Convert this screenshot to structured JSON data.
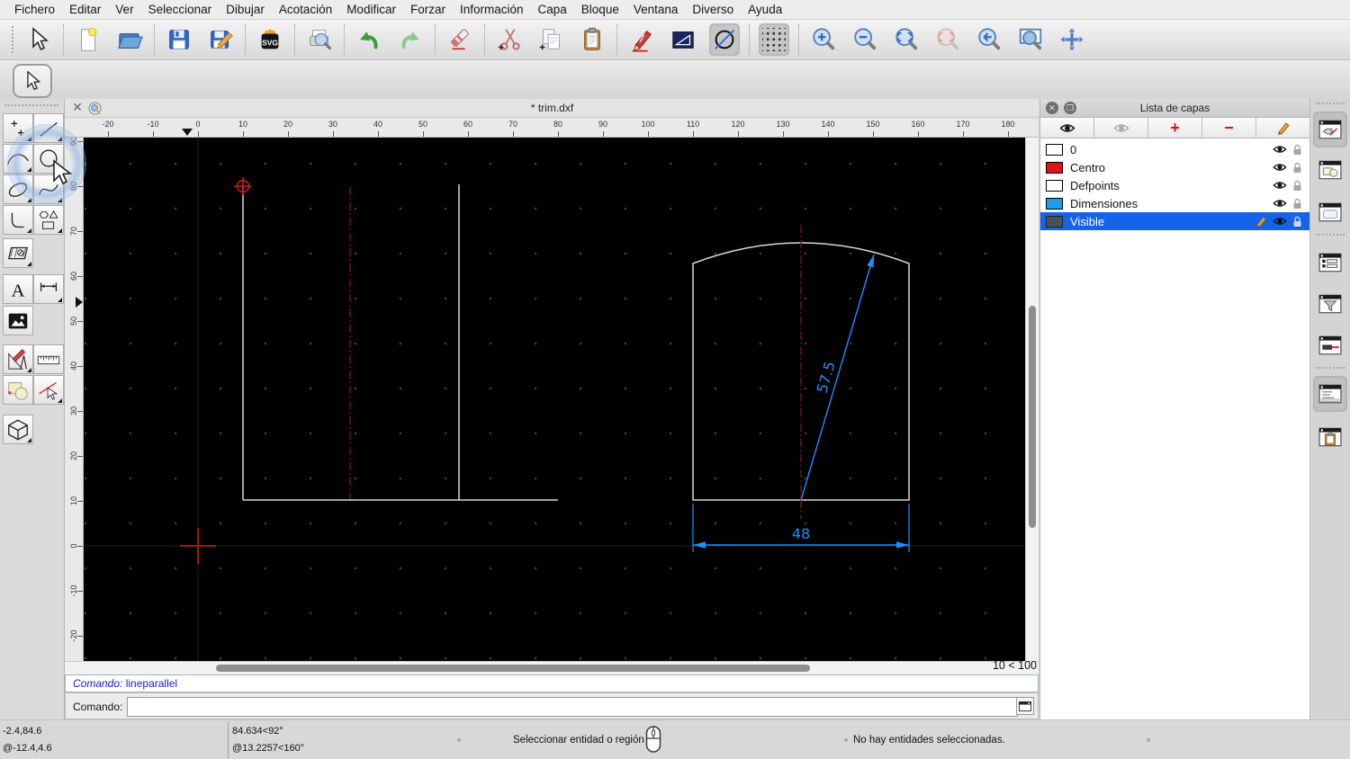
{
  "menu_bar": {
    "items": [
      "Fichero",
      "Editar",
      "Ver",
      "Seleccionar",
      "Dibujar",
      "Acotación",
      "Modificar",
      "Forzar",
      "Información",
      "Capa",
      "Bloque",
      "Ventana",
      "Diverso",
      "Ayuda"
    ]
  },
  "main_toolbar": {
    "buttons": [
      "select-pointer",
      "new-file",
      "open-file",
      "save",
      "save-as",
      "export-svg",
      "print-preview",
      "undo",
      "redo",
      "delete-eraser",
      "cut",
      "copy",
      "paste",
      "draw-pencil",
      "line-angle",
      "circle-trim",
      "grid-toggle",
      "zoom-in",
      "zoom-out",
      "zoom-auto",
      "zoom-selection",
      "zoom-previous",
      "zoom-window",
      "zoom-pan"
    ],
    "active_buttons": [
      "circle-trim",
      "grid-toggle"
    ],
    "disabled_buttons": [
      "zoom-selection"
    ]
  },
  "left_palette": {
    "tools": [
      "points",
      "lines",
      "arcs",
      "circles",
      "ellipses",
      "splines",
      "polylines",
      "shapes",
      "hatch",
      "text",
      "dimensions",
      "image",
      "misc-tools",
      "ruler",
      "modify",
      "trim",
      "isometric"
    ],
    "hovered_tool": "circles"
  },
  "document_tab": {
    "title": "* trim.dxf"
  },
  "rulers": {
    "horizontal": [
      "-20",
      "-10",
      "0",
      "10",
      "20",
      "30",
      "40",
      "50",
      "60",
      "70",
      "80",
      "90",
      "100",
      "110",
      "120",
      "130",
      "140",
      "150",
      "160",
      "170",
      "180"
    ],
    "vertical": [
      "90",
      "80",
      "70",
      "60",
      "50",
      "40",
      "30",
      "20",
      "10",
      "0",
      "-10",
      "-20"
    ]
  },
  "drawing": {
    "dim_diagonal_label": "57.5",
    "dim_width_label": "48",
    "line_color": "#d8d8d8",
    "centerline_color": "#7d1111",
    "dimension_color": "#1f8fff",
    "origin_cross_color": "#a51212"
  },
  "viewport": {
    "grid_scale": "10 < 100"
  },
  "layer_panel": {
    "title": "Lista de capas",
    "layers": [
      {
        "name": "0",
        "color": "#ffffff",
        "selected": false
      },
      {
        "name": "Centro",
        "color": "#e11212",
        "selected": false
      },
      {
        "name": "Defpoints",
        "color": "#ffffff",
        "selected": false
      },
      {
        "name": "Dimensiones",
        "color": "#1e9aef",
        "selected": false
      },
      {
        "name": "Visible",
        "color": "#49505a",
        "selected": true
      }
    ]
  },
  "right_dock_bar": {
    "buttons": [
      "layer-list",
      "block-list",
      "library-browser",
      "entity-list",
      "entity-filter",
      "pen-wizard",
      "command-line",
      "clipboard"
    ],
    "active_buttons": [
      "layer-list",
      "command-line"
    ]
  },
  "command": {
    "history_prompt": "Comando:",
    "history_text": "lineparallel",
    "prompt": "Comando:",
    "input_value": ""
  },
  "status_bar": {
    "abs_coord": "-2.4,84.6",
    "rel_coord": "@-12.4,4.6",
    "abs_polar": "84.634<92°",
    "rel_polar": "@13.2257<160°",
    "hint": "Seleccionar entidad o región",
    "selection_status": "No hay entidades seleccionadas."
  }
}
